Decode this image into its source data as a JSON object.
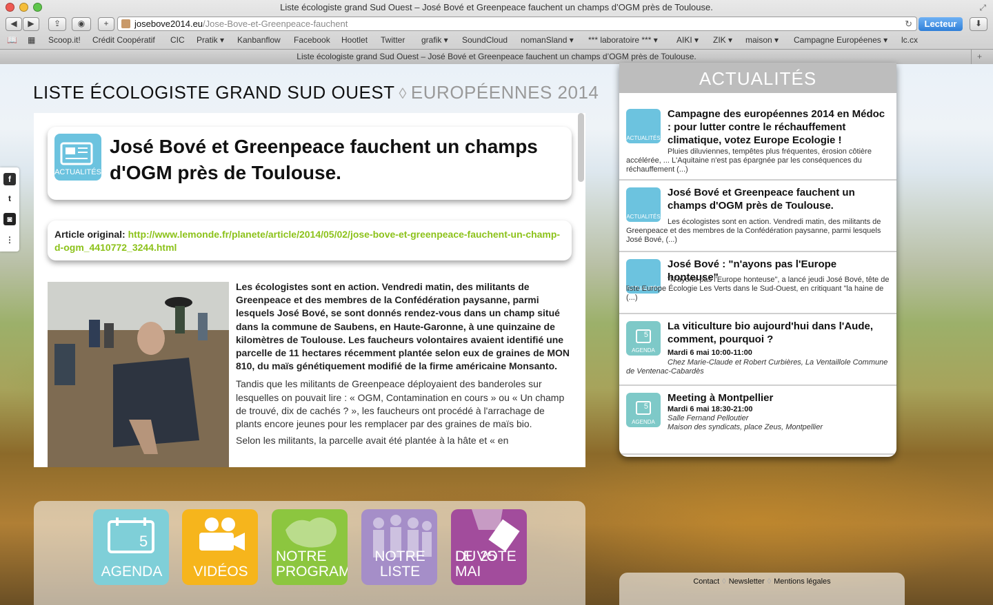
{
  "browser": {
    "window_title": "Liste écologiste grand Sud Ouest – José Bové et Greenpeace fauchent un champs d’OGM près de Toulouse.",
    "url_domain": "josebove2014.eu",
    "url_path": "/Jose-Bove-et-Greenpeace-fauchent",
    "reader_label": "Lecteur",
    "tab_title": "Liste écologiste grand Sud Ouest – José Bové et Greenpeace fauchent un champs d’OGM près de Toulouse.",
    "bookmarks": [
      "Scoop.it!",
      "Crédit Coopératif",
      "CIC",
      "Pratik ▾",
      "Kanbanflow",
      "Facebook",
      "Hootlet",
      "Twitter",
      "grafik ▾",
      "SoundCloud",
      "nomanSland ▾",
      "*** laboratoire *** ▾",
      "AIKI ▾",
      "ZIK ▾",
      "maison ▾",
      "Campagne Européenes ▾",
      "lc.cx"
    ]
  },
  "site": {
    "title": "LISTE ÉCOLOGISTE GRAND SUD OUEST",
    "separator": "◊",
    "subtitle": "EUROPÉENNES 2014"
  },
  "social": {
    "facebook": "f",
    "twitter": "t",
    "instagram": "◙",
    "other": "⋮"
  },
  "article": {
    "category_label": "ACTUALITÉS",
    "headline": "José Bové et Greenpeace fauchent un champs d'OGM près de Toulouse.",
    "original_label": "Article original:",
    "original_link": "http://www.lemonde.fr/planete/article/2014/05/02/jose-bove-et-greenpeace-fauchent-un-champ-d-ogm_4410772_3244.html",
    "lead": "Les écologistes sont en action. Vendredi matin, des militants de Greenpeace et des membres de la Confédération paysanne, parmi lesquels José Bové, se sont donnés rendez-vous dans un champ situé dans la commune de Saubens, en Haute-Garonne, à une quinzaine de kilomètres de Toulouse. Les faucheurs volontaires avaient identifié une parcelle de 11 hectares récemment plantée selon eux de graines de MON 810, du maïs génétiquement modifié de la firme américaine Monsanto.",
    "para2": "Tandis que les militants de Greenpeace déployaient des banderoles sur lesquelles on pouvait lire : « OGM, Contamination en cours » ou « Un champ de trouvé, dix de cachés ? », les faucheurs ont procédé à l'arrachage de plants encore jeunes pour les remplacer par des graines de maïs bio.",
    "para3": "Selon les militants, la parcelle avait été plantée à la hâte et « en"
  },
  "sidebar": {
    "heading": "ACTUALITÉS",
    "news_icon_label": "ACTUALITÉS",
    "agenda_icon_label": "AGENDA",
    "agenda_icon_day": "5",
    "items": [
      {
        "title": "Campagne des européennes 2014 en Médoc : pour lutter contre le réchauffement climatique, votez Europe Ecologie !",
        "desc": "Pluies diluviennes, tempêtes plus fréquentes, érosion côtière accélérée, ... L'Aquitaine n'est pas épargnée par les conséquences du réchauffement (...)"
      },
      {
        "title": "José Bové et Greenpeace fauchent un champs d'OGM près de Toulouse.",
        "desc": "Les écologistes sont en action. Vendredi matin, des militants de Greenpeace et des membres de la Confédération paysanne, parmi lesquels José Bové, (...)"
      },
      {
        "title": "José Bové : \"n'ayons pas l'Europe honteuse\"",
        "desc": "\"N'ayons pas l'Europe honteuse\", a lancé jeudi José Bové, tête de liste Europe Écologie Les Verts dans le Sud-Ouest, en critiquant \"la haine de (...)"
      },
      {
        "title": "La viticulture bio aujourd'hui dans l'Aude, comment, pourquoi ?",
        "date": "Mardi 6 mai 10:00-11:00",
        "place": "Chez Marie-Claude et Robert Curbières, La Ventaillole Commune de Ventenac-Cabardès"
      },
      {
        "title": "Meeting à Montpellier",
        "date": "Mardi 6 mai 18:30-21:00",
        "place1": "Salle Fernand Pelloutier",
        "place2": "Maison des syndicats, place Zeus, Montpellier"
      }
    ]
  },
  "nav": [
    {
      "label": "AGENDA",
      "color": "#7fcfd8"
    },
    {
      "label": "VIDÉOS",
      "color": "#f6b51c"
    },
    {
      "label1": "NOTRE",
      "label2": "PROGRAMME",
      "color": "#8cc63f"
    },
    {
      "label": "NOTRE LISTE",
      "color": "#a58ec8"
    },
    {
      "label1": "LE VOTE",
      "label2": "DU 25 MAI",
      "color": "#a24c9c"
    }
  ],
  "footer": {
    "contact": "Contact",
    "newsletter": "Newsletter",
    "legal": "Mentions légales",
    "sep": "◊"
  }
}
